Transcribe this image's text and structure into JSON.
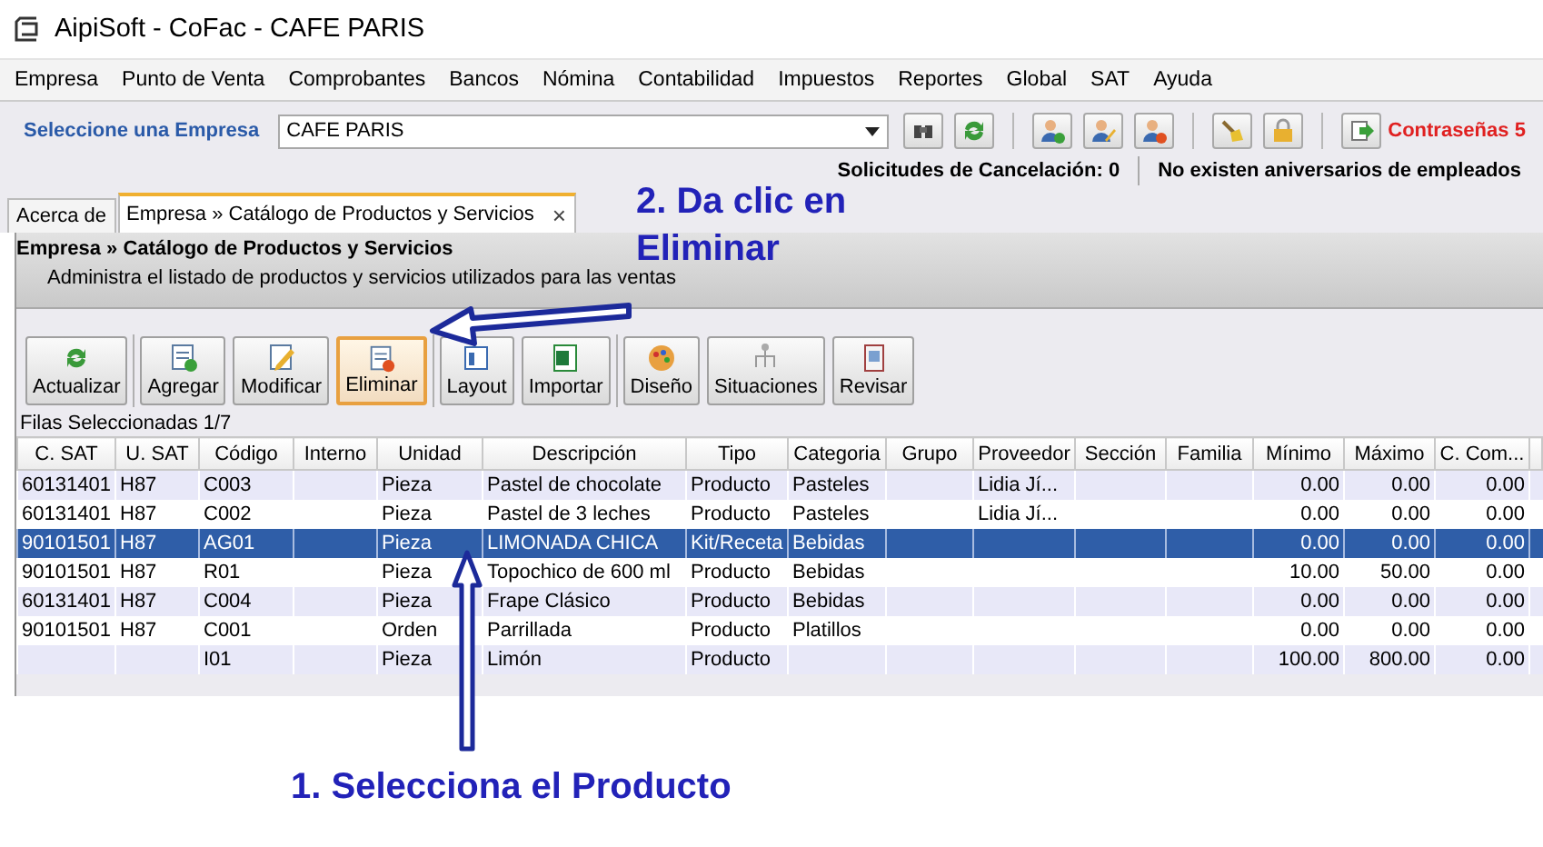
{
  "window": {
    "title": "AipiSoft - CoFac - CAFE PARIS"
  },
  "menu": [
    "Empresa",
    "Punto de Venta",
    "Comprobantes",
    "Bancos",
    "Nómina",
    "Contabilidad",
    "Impuestos",
    "Reportes",
    "Global",
    "SAT",
    "Ayuda"
  ],
  "company_bar": {
    "label": "Seleccione una Empresa",
    "company": "CAFE PARIS",
    "passwords": "Contraseñas 5",
    "cancellations": "Solicitudes de Cancelación: 0",
    "anniversaries": "No existen aniversarios de empleados"
  },
  "tabs": [
    {
      "label": "Acerca de",
      "selected": false
    },
    {
      "label": "Empresa » Catálogo de Productos y Servicios",
      "selected": true,
      "close": "×"
    }
  ],
  "header": {
    "title": "Empresa » Catálogo de Productos y Servicios",
    "description": "Administra el listado de productos y servicios utilizados para las ventas"
  },
  "button_groups": [
    [
      {
        "label": "Actualizar",
        "selected": false
      }
    ],
    [
      {
        "label": "Agregar",
        "selected": false
      },
      {
        "label": "Modificar",
        "selected": false
      },
      {
        "label": "Eliminar",
        "selected": true
      }
    ],
    [
      {
        "label": "Layout",
        "selected": false
      },
      {
        "label": "Importar",
        "selected": false
      }
    ],
    [
      {
        "label": "Diseño",
        "selected": false
      },
      {
        "label": "Situaciones",
        "selected": false
      },
      {
        "label": "Revisar",
        "selected": false
      }
    ]
  ],
  "selection_count": "Filas Seleccionadas  1/7",
  "table": {
    "columns": [
      "C. SAT",
      "U. SAT",
      "Código",
      "Interno",
      "Unidad",
      "Descripción",
      "Tipo",
      "Categoria",
      "Grupo",
      "Proveedor",
      "Sección",
      "Familia",
      "Mínimo",
      "Máximo",
      "C. Com..."
    ],
    "rows": [
      {
        "selected": false,
        "cells": [
          "60131401",
          "H87",
          "C003",
          null,
          "Pieza",
          "Pastel de chocolate",
          "Producto",
          "Pasteles",
          null,
          "Lidia Jí...",
          null,
          null,
          "0.00",
          "0.00",
          "0.00"
        ]
      },
      {
        "selected": false,
        "cells": [
          "60131401",
          "H87",
          "C002",
          null,
          "Pieza",
          "Pastel de 3 leches",
          "Producto",
          "Pasteles",
          null,
          "Lidia Jí...",
          null,
          null,
          "0.00",
          "0.00",
          "0.00"
        ]
      },
      {
        "selected": true,
        "cells": [
          "90101501",
          "H87",
          "AG01",
          null,
          "Pieza",
          "LIMONADA CHICA",
          "Kit/Receta",
          "Bebidas",
          null,
          null,
          null,
          null,
          "0.00",
          "0.00",
          "0.00"
        ]
      },
      {
        "selected": false,
        "cells": [
          "90101501",
          "H87",
          "R01",
          null,
          "Pieza",
          "Topochico de 600 ml",
          "Producto",
          "Bebidas",
          null,
          null,
          null,
          null,
          "10.00",
          "50.00",
          "0.00"
        ]
      },
      {
        "selected": false,
        "cells": [
          "60131401",
          "H87",
          "C004",
          null,
          "Pieza",
          "Frape Clásico",
          "Producto",
          "Bebidas",
          null,
          null,
          null,
          null,
          "0.00",
          "0.00",
          "0.00"
        ]
      },
      {
        "selected": false,
        "cells": [
          "90101501",
          "H87",
          "C001",
          null,
          "Orden",
          "Parrillada",
          "Producto",
          "Platillos",
          null,
          null,
          null,
          null,
          "0.00",
          "0.00",
          "0.00"
        ]
      },
      {
        "selected": false,
        "cells": [
          null,
          null,
          "I01",
          null,
          "Pieza",
          "Limón",
          "Producto",
          null,
          null,
          null,
          null,
          null,
          "100.00",
          "800.00",
          "0.00"
        ]
      }
    ]
  },
  "annotations": [
    {
      "text": "2. Da clic en Eliminar"
    },
    {
      "text": "1. Selecciona el Producto"
    }
  ]
}
